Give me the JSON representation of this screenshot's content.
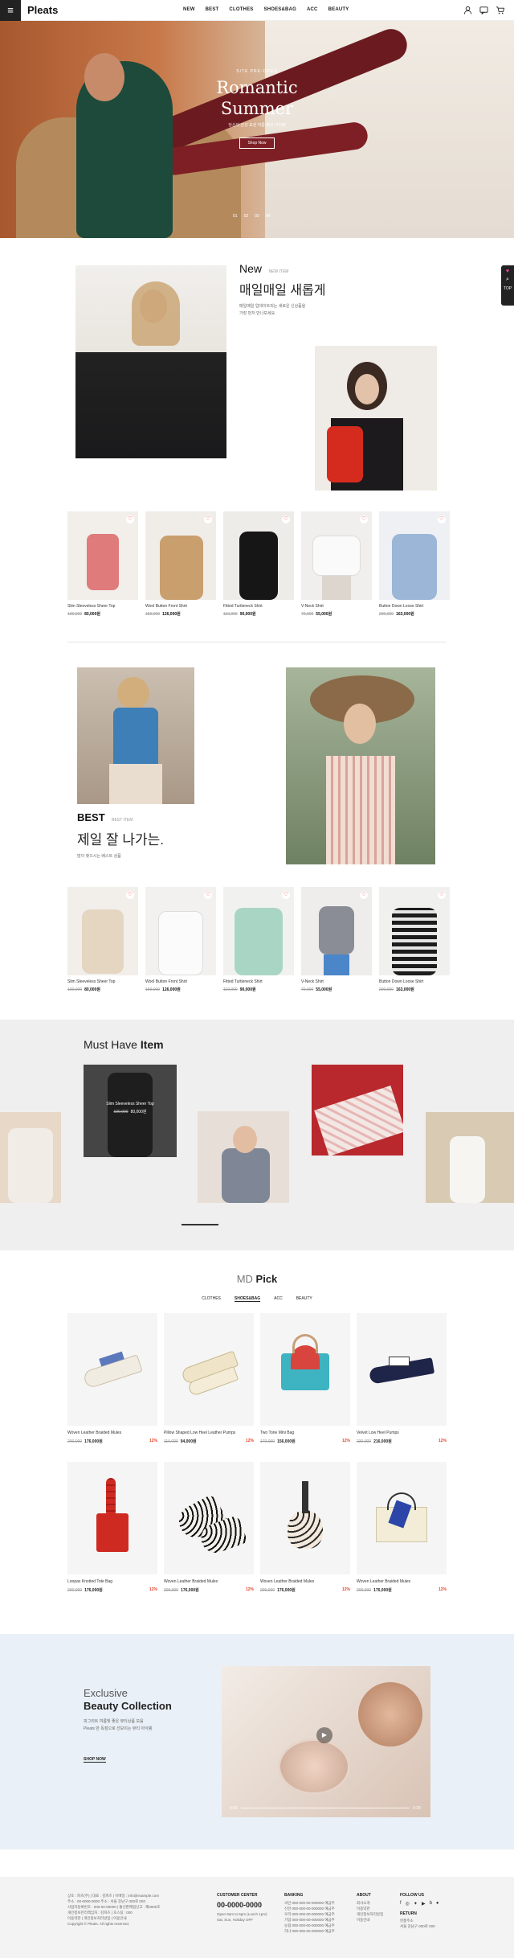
{
  "header": {
    "logo": "Pleats",
    "nav": [
      "NEW",
      "BEST",
      "CLOTHES",
      "SHOES&BAG",
      "ACC",
      "BEAUTY"
    ]
  },
  "hero": {
    "sub": "SITE PRE-OPEN",
    "title1": "Romantic",
    "title2": "Summer",
    "desc": "당신의 감성 표현 여름 패션 아이템",
    "button": "Shop Now",
    "dots": [
      "01",
      "02",
      "03",
      "04"
    ]
  },
  "quick": {
    "label": "TOP"
  },
  "new_section": {
    "tag": "New",
    "tag_sub": "NEW ITEM",
    "title": "매일매일 새롭게",
    "desc1": "매일매일 업데이트되는 새로운 신상품을",
    "desc2": "가장 먼저 만나보세요."
  },
  "new_products": [
    {
      "name": "Slim Sleeveless Sheer Top",
      "orig": "100,000",
      "price": "80,000원"
    },
    {
      "name": "Wool Button Front Shirt",
      "orig": "150,000",
      "price": "126,000원"
    },
    {
      "name": "Fitted Turtleneck Shirt",
      "orig": "110,000",
      "price": "90,000원"
    },
    {
      "name": "V-Neck Shirt",
      "orig": "70,000",
      "price": "55,000원"
    },
    {
      "name": "Button Down Loose Shirt",
      "orig": "200,000",
      "price": "163,000원"
    }
  ],
  "best_section": {
    "tag": "BEST",
    "tag_sub": "BEST ITEM",
    "title": "제일 잘 나가는.",
    "desc": "많이 찾으시는 베스트 상품"
  },
  "best_products": [
    {
      "name": "Slim Sleeveless Sheer Top",
      "orig": "100,000",
      "price": "80,000원"
    },
    {
      "name": "Wool Button Front Shirt",
      "orig": "150,000",
      "price": "126,000원"
    },
    {
      "name": "Fitted Turtleneck Shirt",
      "orig": "110,000",
      "price": "90,000원"
    },
    {
      "name": "V-Neck Shirt",
      "orig": "70,000",
      "price": "55,000원"
    },
    {
      "name": "Button Down Loose Shirt",
      "orig": "200,000",
      "price": "163,000원"
    }
  ],
  "must_have": {
    "title1": "Must Have",
    "title2": "Item",
    "overlay_name": "Slim Sleeveless Sheer Top",
    "overlay_orig": "100,000",
    "overlay_price": "80,000원"
  },
  "md_pick": {
    "title1": "MD",
    "title2": "Pick",
    "tabs": [
      "CLOTHES",
      "SHOES&BAG",
      "ACC",
      "BEAUTY"
    ],
    "items": [
      {
        "name": "Woven Leather Braided Mules",
        "orig": "200,000",
        "price": "176,000원",
        "pct": "12%"
      },
      {
        "name": "Pillow Shaped Low Heel Leather Pumps",
        "orig": "110,000",
        "price": "94,000원",
        "pct": "12%"
      },
      {
        "name": "Two Tone Mini Bag",
        "orig": "170,000",
        "price": "156,000원",
        "pct": "12%"
      },
      {
        "name": "Velvet Low Heel Pumps",
        "orig": "230,000",
        "price": "216,000원",
        "pct": "12%"
      },
      {
        "name": "Loopax Knotted Tote Bag",
        "orig": "200,000",
        "price": "176,000원",
        "pct": "12%"
      },
      {
        "name": "Woven Leather Braided Mules",
        "orig": "200,000",
        "price": "176,000원",
        "pct": "12%"
      },
      {
        "name": "Woven Leather Braided Mules",
        "orig": "200,000",
        "price": "176,000원",
        "pct": "12%"
      },
      {
        "name": "Woven Leather Braided Mules",
        "orig": "200,000",
        "price": "176,000원",
        "pct": "12%"
      }
    ]
  },
  "beauty": {
    "title1": "Exclusive",
    "title2": "Beauty Collection",
    "desc1": "피그리트 여름빛 좋은 뷰티상품 모음",
    "desc2": "Pleats 만 독점으로 선보이는 뷰티 아이템",
    "button": "SHOP NOW",
    "time_start": "0:00",
    "time_end": "0:30"
  },
  "footer": {
    "info": [
      "상호 : 피츠(주) | 대표 : 김피츠 | 이메일 : info@example.com",
      "주소 : 00-0000-0000 주소 : 서울 강남구 000로 000",
      "사업자등록번호 : 000-00-00000 | 통신판매업신고 : 제0000호",
      "개인정보관리책임자 : 김피츠 | 호스팅 : 000",
      "이용약관 | 개인정보처리방침 | 이용안내",
      "Copyright © Pleats. All rights reserved."
    ],
    "cs_title": "CUSTOMER CENTER",
    "cs_phone": "00-0000-0000",
    "cs_hours": [
      "Open 9am to 6pm (Lunch 1pm)",
      "Sat, Sun, Holiday OFF"
    ],
    "bank_title": "BANKING",
    "bank_lines": [
      "국민 000-000-00-000000 예금주",
      "신한 000-000-00-000000 예금주",
      "우리 000-000-00-000000 예금주",
      "기업 000-000-00-000000 예금주",
      "농협 000-000-00-000000 예금주",
      "하나 000-000-00-000000 예금주"
    ],
    "about_title": "ABOUT",
    "about_lines": [
      "회사소개",
      "이용약관",
      "개인정보처리방침",
      "이용안내"
    ],
    "follow_title": "FOLLOW US",
    "return_title": "RETURN",
    "return_lines": [
      "반품주소",
      "서울 강남구 000로 000"
    ]
  }
}
